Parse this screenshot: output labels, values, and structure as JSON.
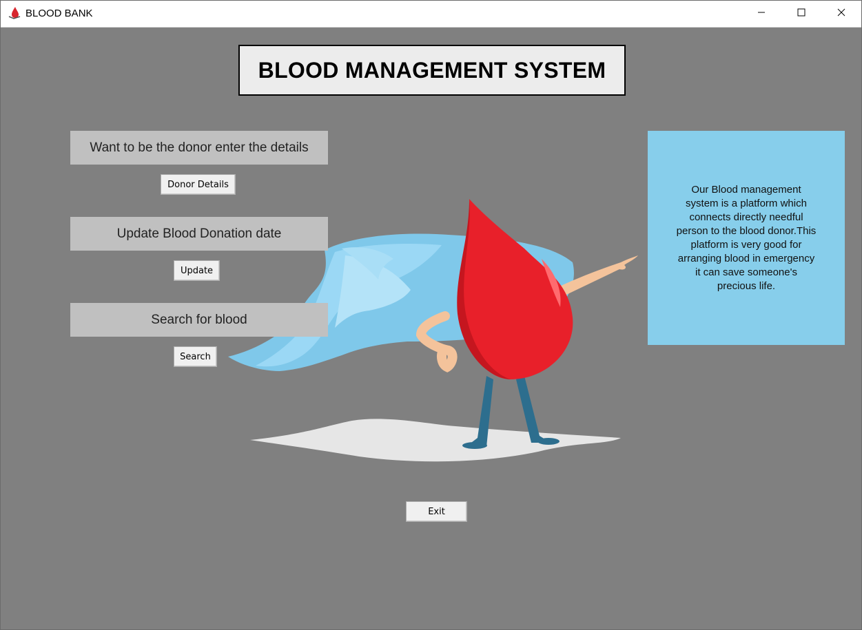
{
  "window": {
    "title": "BLOOD BANK",
    "app_icon": "blood-drop-icon",
    "controls": [
      "minimize-icon",
      "maximize-icon",
      "close-icon"
    ]
  },
  "header": {
    "title": "BLOOD MANAGEMENT SYSTEM"
  },
  "sections": {
    "donor": {
      "label": "Want to be the donor enter the details",
      "button": "Donor Details"
    },
    "update": {
      "label": "Update Blood Donation date",
      "button": "Update"
    },
    "search": {
      "label": "Search for blood",
      "button": "Search"
    }
  },
  "info": {
    "text": "Our Blood management\nsystem is a platform  which\nconnects directly needful\nperson to the blood donor.This\nplatform is very good for\narranging blood in emergency\nit can save someone's\nprecious life."
  },
  "footer": {
    "exit_label": "Exit"
  },
  "illustration": {
    "icon": "blood-drop-superhero-illustration"
  },
  "colors": {
    "background": "#808080",
    "label_bg": "#c0c0c0",
    "info_bg": "#87ceeb",
    "title_bg": "#ececec",
    "drop_red": "#e8202a"
  }
}
